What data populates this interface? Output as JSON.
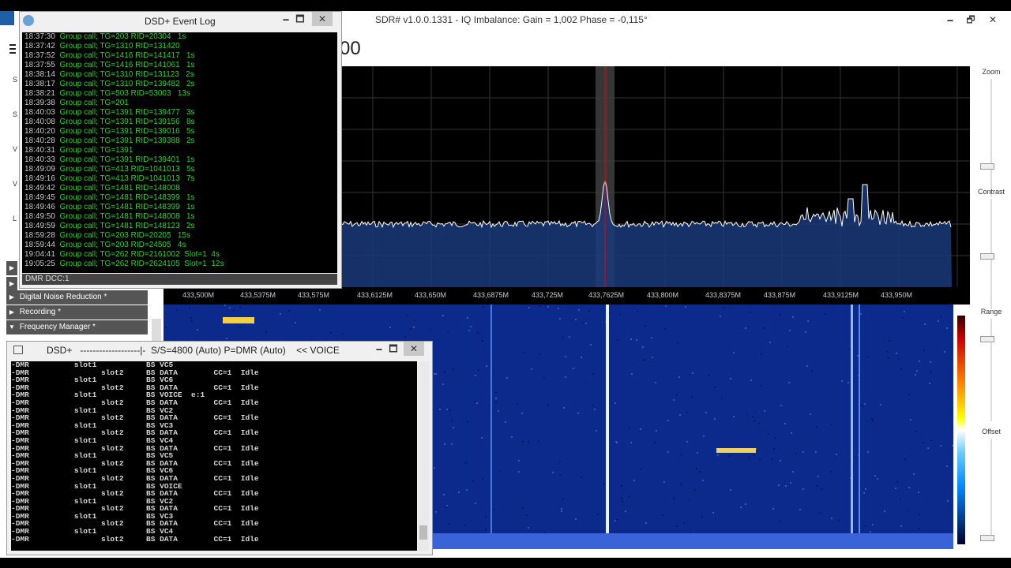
{
  "sdr": {
    "title": "SDR# v1.0.0.1331 - IQ Imbalance: Gain = 1,002 Phase = -0,115°",
    "freq_partial": "00",
    "controls": {
      "minimize": "🗕",
      "maximize": "🗗",
      "close": "✕"
    },
    "freq_labels": [
      "433,500M",
      "433,5375M",
      "433,575M",
      "433,6125M",
      "433,650M",
      "433,6875M",
      "433,725M",
      "433,7625M",
      "433,800M",
      "433,8375M",
      "433,875M",
      "433,9125M",
      "433,950M"
    ],
    "right": {
      "zoom": "Zoom",
      "contrast": "Contrast",
      "range": "Range",
      "offset": "Offset"
    },
    "left_panels": [
      {
        "arrow": "▶",
        "label": "Digital Noise Reduction *"
      },
      {
        "arrow": "▶",
        "label": "Recording *"
      },
      {
        "arrow": "▼",
        "label": "Frequency Manager *"
      }
    ]
  },
  "evlog": {
    "title": "DSD+ Event Log",
    "status": "DMR  DCC:1",
    "controls": {
      "minimize": "🗕",
      "maximize": "🗖",
      "close": "✕"
    },
    "rows": [
      {
        "t": "18:37:30",
        "m": "Group call; TG=203 RID=20304   1s"
      },
      {
        "t": "18:37:42",
        "m": "Group call; TG=1310 RID=131420"
      },
      {
        "t": "18:37:52",
        "m": "Group call; TG=1416 RID=141417   1s"
      },
      {
        "t": "18:37:55",
        "m": "Group call; TG=1416 RID=141061   1s"
      },
      {
        "t": "18:38:14",
        "m": "Group call; TG=1310 RID=131123   2s"
      },
      {
        "t": "18:38:17",
        "m": "Group call; TG=1310 RID=139482   2s"
      },
      {
        "t": "18:38:21",
        "m": "Group call; TG=503 RID=53003   13s"
      },
      {
        "t": "18:39:38",
        "m": "Group call; TG=201"
      },
      {
        "t": "18:40:03",
        "m": "Group call; TG=1391 RID=139477   3s"
      },
      {
        "t": "18:40:08",
        "m": "Group call; TG=1391 RID=139156   8s"
      },
      {
        "t": "18:40:20",
        "m": "Group call; TG=1391 RID=139016   5s"
      },
      {
        "t": "18:40:28",
        "m": "Group call; TG=1391 RID=139388   2s"
      },
      {
        "t": "18:40:31",
        "m": "Group call; TG=1391"
      },
      {
        "t": "18:40:33",
        "m": "Group call; TG=1391 RID=139401   1s"
      },
      {
        "t": "18:49:09",
        "m": "Group call; TG=413 RID=1041013   5s"
      },
      {
        "t": "18:49:16",
        "m": "Group call; TG=413 RID=1041013   7s"
      },
      {
        "t": "18:49:42",
        "m": "Group call; TG=1481 RID=148008"
      },
      {
        "t": "18:49:45",
        "m": "Group call; TG=1481 RID=148399   1s"
      },
      {
        "t": "18:49:46",
        "m": "Group call; TG=1481 RID=148399   1s"
      },
      {
        "t": "18:49:50",
        "m": "Group call; TG=1481 RID=148008   1s"
      },
      {
        "t": "18:49:59",
        "m": "Group call; TG=1481 RID=148123   2s"
      },
      {
        "t": "18:59:28",
        "m": "Group call; TG=203 RID=20205   15s"
      },
      {
        "t": "18:59:44",
        "m": "Group call; TG=203 RID=24505   4s"
      },
      {
        "t": "19:04:41",
        "m": "Group call; TG=262 RID=2161002  Slot=1  4s"
      },
      {
        "t": "19:05:25",
        "m": "Group call; TG=262 RID=2624105  Slot=1  12s"
      }
    ]
  },
  "dsd": {
    "title": "DSD+   -------------------|-  S/S=4800 (Auto) P=DMR (Auto)    << VOICE",
    "controls": {
      "minimize": "🗕",
      "maximize": "🗖",
      "close": "✕"
    },
    "lines": [
      "-DMR          slot1           BS VC5",
      "-DMR                slot2     BS DATA        CC=1  Idle",
      "-DMR          slot1           BS VC6",
      "-DMR                slot2     BS DATA        CC=1  Idle",
      "-DMR          slot1           BS VOICE  e:1",
      "-DMR                slot2     BS DATA        CC=1  Idle",
      "-DMR          slot1           BS VC2",
      "-DMR                slot2     BS DATA        CC=1  Idle",
      "-DMR          slot1           BS VC3",
      "-DMR                slot2     BS DATA        CC=1  Idle",
      "-DMR          slot1           BS VC4",
      "-DMR                slot2     BS DATA        CC=1  Idle",
      "-DMR          slot1           BS VC5",
      "-DMR                slot2     BS DATA        CC=1  Idle",
      "-DMR          slot1           BS VC6",
      "-DMR                slot2     BS DATA        CC=1  Idle",
      "-DMR          slot1           BS VOICE",
      "-DMR                slot2     BS DATA        CC=1  Idle",
      "-DMR          slot1           BS VC2",
      "-DMR                slot2     BS DATA        CC=1  Idle",
      "-DMR          slot1           BS VC3",
      "-DMR                slot2     BS DATA        CC=1  Idle",
      "-DMR          slot1           BS VC4",
      "-DMR                slot2     BS DATA        CC=1  Idle"
    ]
  }
}
